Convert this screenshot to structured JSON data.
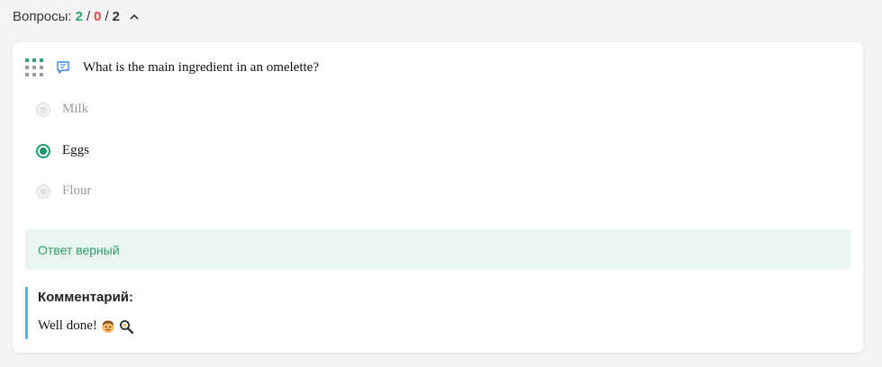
{
  "header": {
    "label": "Вопросы:",
    "correct": "2",
    "separator": "/",
    "wrong": "0",
    "total": "2",
    "chevron_icon": "chevron-up-icon"
  },
  "question": {
    "drag_icon": "drag-handle-icon",
    "type_icon": "comment-icon",
    "text": "What is the main ingredient in an omelette?",
    "options": [
      {
        "label": "Milk",
        "state": "disabled"
      },
      {
        "label": "Eggs",
        "state": "selected"
      },
      {
        "label": "Flour",
        "state": "disabled"
      }
    ]
  },
  "result": {
    "text": "Ответ верный"
  },
  "comment": {
    "title": "Комментарий:",
    "text": "Well done!",
    "emojis": [
      "boy-face-icon",
      "frying-pan-egg-icon"
    ]
  },
  "colors": {
    "correct": "#2fa36b",
    "wrong": "#e0474c",
    "accent": "#1a9b72",
    "result_bg": "#e8f6ef",
    "comment_border": "#4cb5ec"
  }
}
